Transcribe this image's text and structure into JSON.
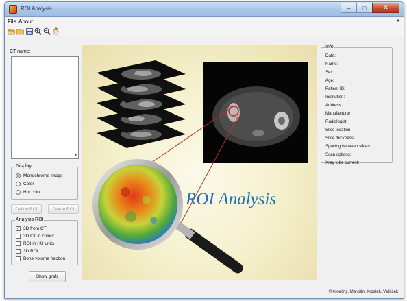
{
  "window": {
    "title": "ROI Analysis",
    "controls": {
      "minimize": "–",
      "maximize": "□",
      "close": "✕"
    }
  },
  "menu": {
    "items": [
      "File",
      "About"
    ]
  },
  "toolbar": {
    "icons": [
      "open-folder-icon",
      "folder-icon",
      "save-icon",
      "zoom-in-icon",
      "zoom-out-icon",
      "pan-hand-icon"
    ]
  },
  "left": {
    "ct_label": "CT name:",
    "display": {
      "title": "Display",
      "options": [
        "Monochrome image",
        "Color",
        "Hot color"
      ],
      "selected": "Monochrome image"
    },
    "buttons": {
      "define_roi": "Define ROI",
      "delete_roi": "Delete ROI"
    },
    "analysis": {
      "title": "Analysis ROI",
      "options": [
        {
          "label": "3D from CT",
          "checked": true
        },
        {
          "label": "3D CT in colour",
          "checked": false
        },
        {
          "label": "ROI in HU units",
          "checked": false
        },
        {
          "label": "3D ROI",
          "checked": false
        },
        {
          "label": "Bone volume fraction",
          "checked": false
        }
      ]
    },
    "show_button": "Show grafs"
  },
  "splash": {
    "title": "ROI Analysis"
  },
  "info": {
    "title": "Info",
    "fields": [
      "Date:",
      "Name:",
      "Sex:",
      "Age:",
      "Patient ID:",
      "Institution:",
      "Address:",
      "Manufacturer:",
      "Radiologist:",
      "Slice location:",
      "Slice thickness:",
      "Spacing between slices:",
      "Scan options:",
      "Xray tube current:"
    ]
  },
  "credits": "©Konečný, Marcián, Krpalek, Vališček"
}
